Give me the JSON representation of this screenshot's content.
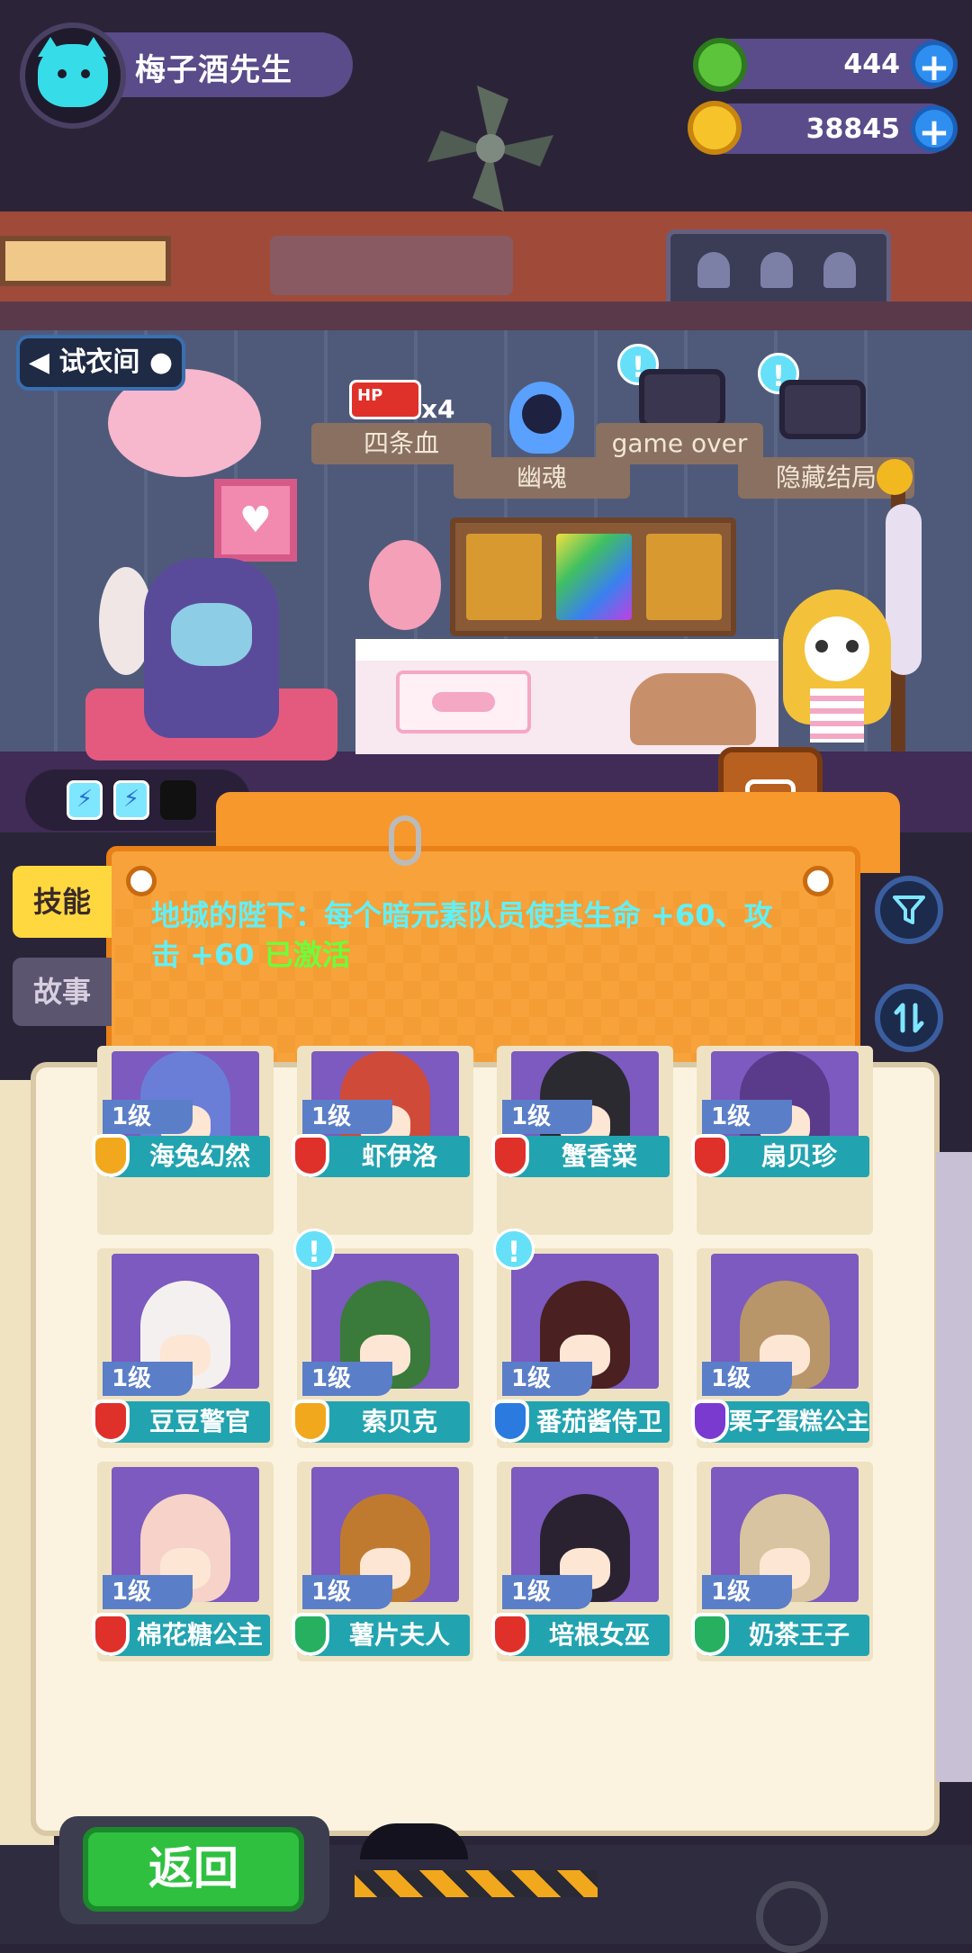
{
  "player": {
    "name": "梅子酒先生"
  },
  "currency": [
    {
      "name": "green-gem",
      "value": "444",
      "color": "#5cc43a"
    },
    {
      "name": "gold-coin",
      "value": "38845",
      "color": "#f6c32a"
    }
  ],
  "room": {
    "fitting_room_button": "试衣间",
    "hp_badge": "HP",
    "hp_multiplier": "x4",
    "tags": [
      "四条血",
      "幽魂",
      "game over",
      "隐藏结局"
    ]
  },
  "tabs": {
    "skill": "技能",
    "story": "故事"
  },
  "skill_info": {
    "text": "地城的陛下：每个暗元素队员使其生命 +60、攻击 +60",
    "status": "已激活"
  },
  "icons": {
    "filter": "filter-icon",
    "sort": "sort-icon",
    "plus": "plus-icon",
    "exclaim": "!"
  },
  "characters": [
    {
      "level": "1级",
      "name": "海兔幻然",
      "badge_color": "#f2a81c",
      "hair": "#6a7ed8",
      "exclaim": false
    },
    {
      "level": "1级",
      "name": "虾伊洛",
      "badge_color": "#e0302a",
      "hair": "#d04a3a",
      "exclaim": false
    },
    {
      "level": "1级",
      "name": "蟹香菜",
      "badge_color": "#e0302a",
      "hair": "#2a2a30",
      "exclaim": false
    },
    {
      "level": "1级",
      "name": "扇贝珍",
      "badge_color": "#e0302a",
      "hair": "#5a3a8a",
      "exclaim": false
    },
    {
      "level": "1级",
      "name": "豆豆警官",
      "badge_color": "#e0302a",
      "hair": "#f4f0f0",
      "exclaim": false
    },
    {
      "level": "1级",
      "name": "索贝克",
      "badge_color": "#f2a81c",
      "hair": "#3a7a3a",
      "exclaim": true
    },
    {
      "level": "1级",
      "name": "番茄酱侍卫",
      "badge_color": "#2a7ae0",
      "hair": "#4a2020",
      "exclaim": true
    },
    {
      "level": "1级",
      "name": "栗子蛋糕公主",
      "badge_color": "#7a3ad0",
      "hair": "#b8966a",
      "exclaim": false
    },
    {
      "level": "1级",
      "name": "棉花糖公主",
      "badge_color": "#e0302a",
      "hair": "#f6d2c8",
      "exclaim": false
    },
    {
      "level": "1级",
      "name": "薯片夫人",
      "badge_color": "#26b060",
      "hair": "#c07a30",
      "exclaim": false
    },
    {
      "level": "1级",
      "name": "培根女巫",
      "badge_color": "#e0302a",
      "hair": "#2a2230",
      "exclaim": false
    },
    {
      "level": "1级",
      "name": "奶茶王子",
      "badge_color": "#26b060",
      "hair": "#d8c4a0",
      "exclaim": false
    }
  ],
  "bottom": {
    "back_button": "返回"
  }
}
